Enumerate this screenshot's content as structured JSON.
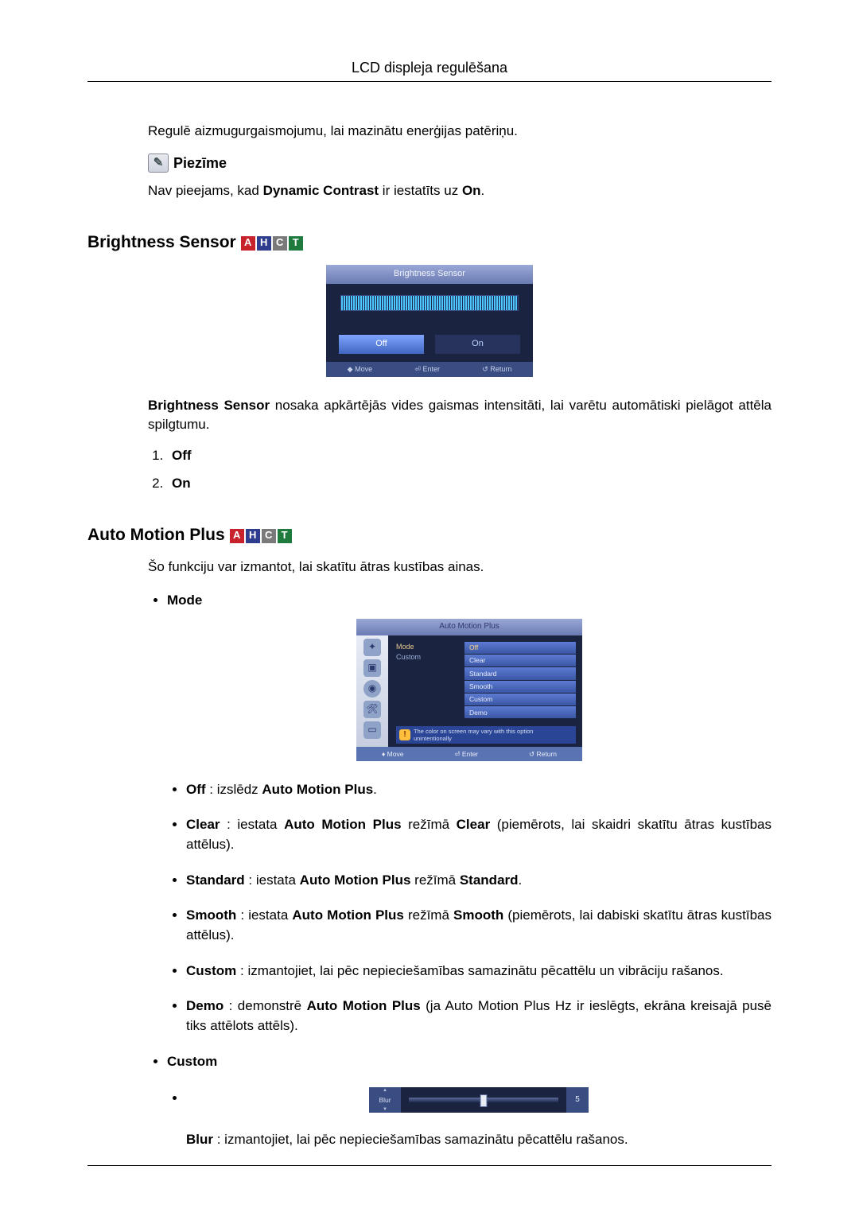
{
  "page_header": "LCD displeja regulēšana",
  "backlight_intro": "Regulē aizmugurgaismojumu, lai mazinātu enerģijas patēriņu.",
  "note_label": "Piezīme",
  "note_text_pre": "Nav pieejams, kad ",
  "note_text_bold": "Dynamic Contrast",
  "note_text_mid": " ir iestatīts uz ",
  "note_text_on": "On",
  "note_text_end": ".",
  "brightness_heading": "Brightness Sensor",
  "osd1": {
    "title": "Brightness Sensor",
    "off": "Off",
    "on": "On",
    "foot_move": "Move",
    "foot_enter": "Enter",
    "foot_return": "Return"
  },
  "brightness_desc_bold": "Brightness Sensor",
  "brightness_desc_rest": " nosaka apkārtējās vides gaismas intensitāti, lai varētu automātiski pielāgot attēla spilgtumu.",
  "bs_list": {
    "i1": "Off",
    "i2": "On"
  },
  "amp_heading": "Auto Motion Plus",
  "amp_intro": "Šo funkciju var izmantot, lai skatītu ātras kustības ainas.",
  "amp_mode_label": "Mode",
  "osd2": {
    "title": "Auto Motion Plus",
    "left_mode": "Mode",
    "left_custom": "Custom",
    "opt_off": "Off",
    "opt_clear": "Clear",
    "opt_standard": "Standard",
    "opt_smooth": "Smooth",
    "opt_custom": "Custom",
    "opt_demo": "Demo",
    "note": "The color on screen may vary with this option unintentionally",
    "foot_move": "Move",
    "foot_enter": "Enter",
    "foot_return": "Return"
  },
  "mode_items": {
    "off_b": "Off",
    "off_t1": " : izslēdz ",
    "off_t2": "Auto Motion Plus",
    "off_t3": ".",
    "clear_b": "Clear",
    "clear_t1": " : iestata ",
    "clear_t2": "Auto Motion Plus",
    "clear_t3": " režīmā ",
    "clear_t4": "Clear",
    "clear_t5": " (piemērots, lai skaidri skatītu ātras kustības attēlus).",
    "std_b": "Standard",
    "std_t1": " : iestata ",
    "std_t2": "Auto Motion Plus",
    "std_t3": " režīmā ",
    "std_t4": "Standard",
    "std_t5": ".",
    "smooth_b": "Smooth",
    "smooth_t1": " : iestata ",
    "smooth_t2": "Auto Motion Plus",
    "smooth_t3": " režīmā ",
    "smooth_t4": "Smooth",
    "smooth_t5": " (piemērots, lai dabiski skatītu ātras kustības attēlus).",
    "custom_b": "Custom",
    "custom_t": " : izmantojiet, lai pēc nepieciešamības samazinātu pēcattēlu un vibrāciju rašanos.",
    "demo_b": "Demo",
    "demo_t1": " : demonstrē ",
    "demo_t2": "Auto Motion Plus",
    "demo_t3": " (ja Auto Motion Plus Hz ir ieslēgts, ekrāna kreisajā pusē tiks attēlots attēls)."
  },
  "custom_label": "Custom",
  "blur": {
    "label": "Blur",
    "value": "5"
  },
  "blur_desc_b": "Blur",
  "blur_desc_t": " : izmantojiet, lai pēc nepieciešamības samazinātu pēcattēlu rašanos."
}
